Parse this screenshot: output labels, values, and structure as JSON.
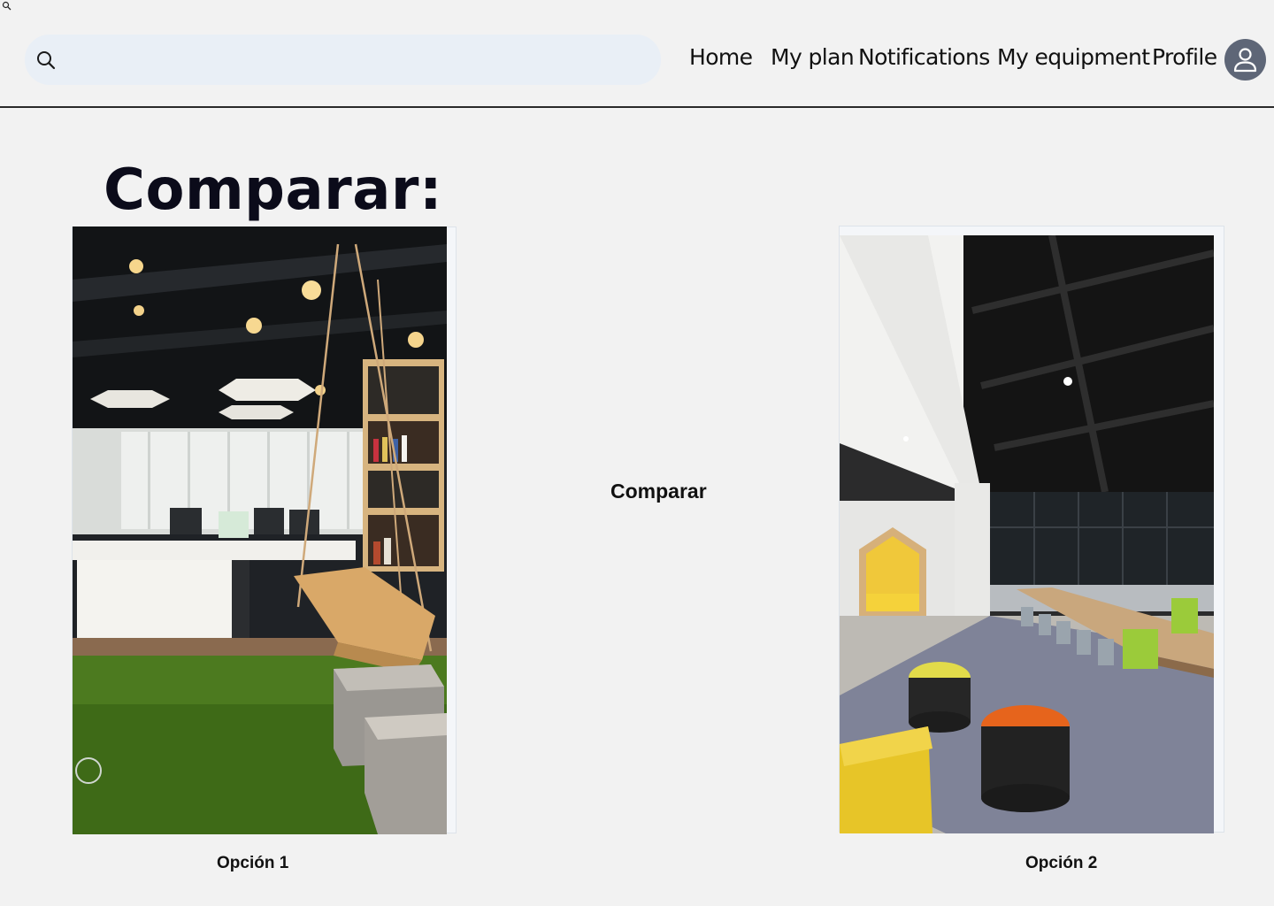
{
  "icons": {
    "corner": "search-icon",
    "search": "search-icon",
    "avatar": "user-icon"
  },
  "search": {
    "placeholder": "",
    "value": ""
  },
  "nav": {
    "home": "Home",
    "my_plan": "My plan",
    "notifications": "Notifications",
    "my_equipment": "My equipment",
    "profile": "Profile"
  },
  "colors": {
    "background": "#f2f2f2",
    "search_bg": "#e9eff6",
    "avatar_bg": "#5e6677"
  },
  "page": {
    "title": "Comparar:"
  },
  "compare": {
    "button_label": "Comparar"
  },
  "options": [
    {
      "label": "Opción 1"
    },
    {
      "label": "Opción 2"
    }
  ]
}
